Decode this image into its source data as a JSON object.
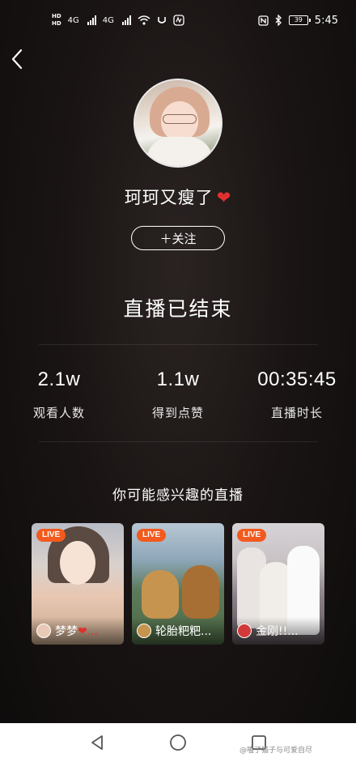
{
  "status_bar": {
    "left_labels": [
      "HD",
      "4G",
      "4G"
    ],
    "battery": "39",
    "time": "5:45",
    "icons": [
      "signal-icon",
      "wifi-icon",
      "nfc-icon",
      "bluetooth-icon",
      "battery-icon"
    ]
  },
  "back_icon": "chevron-left-icon",
  "profile": {
    "username": "珂珂又瘦了",
    "heart": "❤"
  },
  "follow_button": {
    "label": "＋关注"
  },
  "ended_title": "直播已结束",
  "stats": [
    {
      "value": "2.1w",
      "label": "观看人数"
    },
    {
      "value": "1.1w",
      "label": "得到点赞"
    },
    {
      "value": "00:35:45",
      "label": "直播时长"
    }
  ],
  "recommend": {
    "title": "你可能感兴趣的直播",
    "cards": [
      {
        "badge": "LIVE",
        "name": "梦梦",
        "heart": "❤..."
      },
      {
        "badge": "LIVE",
        "name": "轮胎粑粑..."
      },
      {
        "badge": "LIVE",
        "name": "金刚!!..."
      }
    ]
  },
  "watermark": "@嗑了猫子与可爱自尽",
  "navbar": {
    "icons": [
      "back-triangle-icon",
      "home-circle-icon",
      "recents-square-icon"
    ]
  },
  "colors": {
    "accent_live": "#f25a1e",
    "heart": "#e0302e",
    "navbar_bg": "#ffffff"
  }
}
